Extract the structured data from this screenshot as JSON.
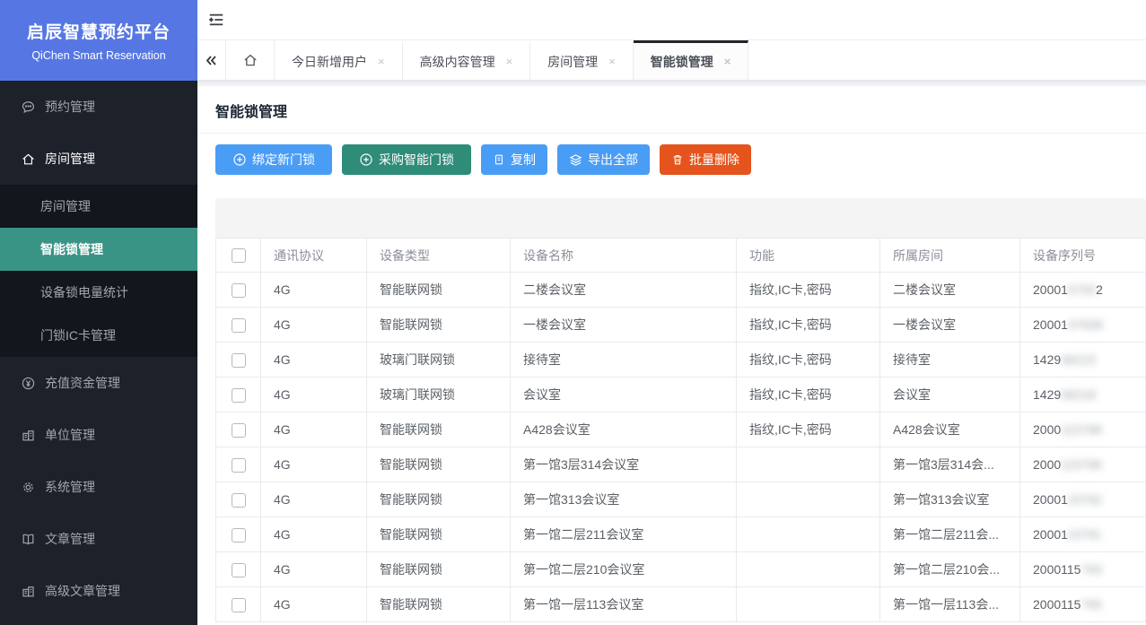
{
  "brand": {
    "title": "启辰智慧预约平台",
    "subtitle": "QiChen Smart Reservation"
  },
  "colors": {
    "brand_blue": "#5677e3",
    "sidebar_active_teal": "#3a9486",
    "primary_blue": "#4a9df5",
    "teal_green": "#2e8c79",
    "danger_orange": "#e4541c"
  },
  "sidebar": {
    "items": [
      {
        "label": "预约管理",
        "icon": "chat-icon",
        "active": false
      },
      {
        "label": "房间管理",
        "icon": "home-icon",
        "active": true,
        "children": [
          {
            "label": "房间管理",
            "active": false
          },
          {
            "label": "智能锁管理",
            "active": true
          },
          {
            "label": "设备锁电量统计",
            "active": false
          },
          {
            "label": "门锁IC卡管理",
            "active": false
          }
        ]
      },
      {
        "label": "充值资金管理",
        "icon": "yen-icon",
        "active": false
      },
      {
        "label": "单位管理",
        "icon": "building-icon",
        "active": false
      },
      {
        "label": "系统管理",
        "icon": "gear-icon",
        "active": false
      },
      {
        "label": "文章管理",
        "icon": "book-icon",
        "active": false
      },
      {
        "label": "高级文章管理",
        "icon": "building-icon",
        "active": false
      }
    ]
  },
  "tabbar": {
    "tabs": [
      {
        "label": "今日新增用户",
        "active": false
      },
      {
        "label": "高级内容管理",
        "active": false
      },
      {
        "label": "房间管理",
        "active": false
      },
      {
        "label": "智能锁管理",
        "active": true
      }
    ],
    "close_glyph": "×"
  },
  "page": {
    "title": "智能锁管理"
  },
  "toolbar": {
    "buttons": [
      {
        "label": "绑定新门锁",
        "icon": "circle-plus-icon",
        "color_key": "primary_blue",
        "size": "large",
        "name": "bind-new-lock-button"
      },
      {
        "label": "采购智能门锁",
        "icon": "circle-plus-icon",
        "color_key": "teal_green",
        "size": "large",
        "name": "purchase-smart-lock-button"
      },
      {
        "label": "复制",
        "icon": "copy-icon",
        "color_key": "primary_blue",
        "size": "small",
        "name": "copy-button"
      },
      {
        "label": "导出全部",
        "icon": "layers-icon",
        "color_key": "primary_blue",
        "size": "small",
        "name": "export-all-button"
      },
      {
        "label": "批量删除",
        "icon": "trash-icon",
        "color_key": "danger_orange",
        "size": "small",
        "name": "batch-delete-button"
      }
    ]
  },
  "table": {
    "columns": [
      "通讯协议",
      "设备类型",
      "设备名称",
      "功能",
      "所属房间",
      "设备序列号"
    ],
    "rows": [
      {
        "protocol": "4G",
        "device_type": "智能联网锁",
        "device_name": "二楼会议室",
        "functions": "指纹,IC卡,密码",
        "room": "二楼会议室",
        "serial_prefix": "20001",
        "serial_redacted": "5793",
        "serial_suffix": "2"
      },
      {
        "protocol": "4G",
        "device_type": "智能联网锁",
        "device_name": "一楼会议室",
        "functions": "指纹,IC卡,密码",
        "room": "一楼会议室",
        "serial_prefix": "20001",
        "serial_redacted": "57938",
        "serial_suffix": ""
      },
      {
        "protocol": "4G",
        "device_type": "玻璃门联网锁",
        "device_name": "接待室",
        "functions": "指纹,IC卡,密码",
        "room": "接待室",
        "serial_prefix": "1429",
        "serial_redacted": "06215",
        "serial_suffix": ""
      },
      {
        "protocol": "4G",
        "device_type": "玻璃门联网锁",
        "device_name": "会议室",
        "functions": "指纹,IC卡,密码",
        "room": "会议室",
        "serial_prefix": "1429",
        "serial_redacted": "06218",
        "serial_suffix": ""
      },
      {
        "protocol": "4G",
        "device_type": "智能联网锁",
        "device_name": "A428会议室",
        "functions": "指纹,IC卡,密码",
        "room": "A428会议室",
        "serial_prefix": "2000",
        "serial_redacted": "115798",
        "serial_suffix": ""
      },
      {
        "protocol": "4G",
        "device_type": "智能联网锁",
        "device_name": "第一馆3层314会议室",
        "functions": "",
        "room": "第一馆3层314会...",
        "serial_prefix": "2000",
        "serial_redacted": "115796",
        "serial_suffix": ""
      },
      {
        "protocol": "4G",
        "device_type": "智能联网锁",
        "device_name": "第一馆313会议室",
        "functions": "",
        "room": "第一馆313会议室",
        "serial_prefix": "20001",
        "serial_redacted": "15792",
        "serial_suffix": ""
      },
      {
        "protocol": "4G",
        "device_type": "智能联网锁",
        "device_name": "第一馆二层211会议室",
        "functions": "",
        "room": "第一馆二层211会...",
        "serial_prefix": "20001",
        "serial_redacted": "15791",
        "serial_suffix": ""
      },
      {
        "protocol": "4G",
        "device_type": "智能联网锁",
        "device_name": "第一馆二层210会议室",
        "functions": "",
        "room": "第一馆二层210会...",
        "serial_prefix": "2000115",
        "serial_redacted": "793",
        "serial_suffix": ""
      },
      {
        "protocol": "4G",
        "device_type": "智能联网锁",
        "device_name": "第一馆一层113会议室",
        "functions": "",
        "room": "第一馆一层113会...",
        "serial_prefix": "2000115",
        "serial_redacted": "795",
        "serial_suffix": ""
      }
    ]
  }
}
